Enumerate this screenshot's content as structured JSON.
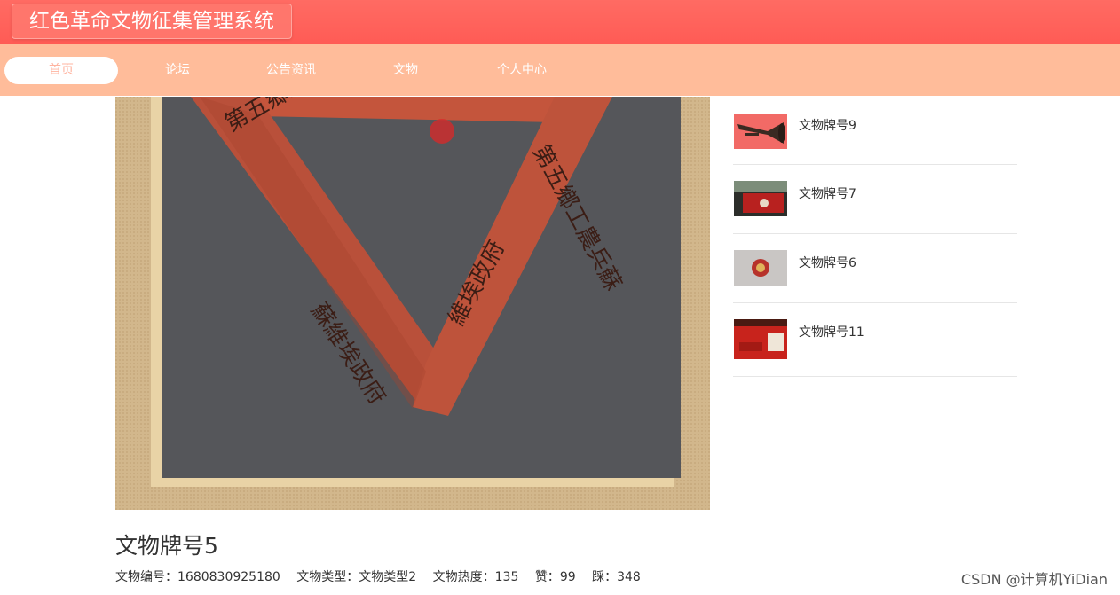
{
  "header": {
    "title": "红色革命文物征集管理系统"
  },
  "nav": {
    "items": [
      {
        "label": "首页",
        "active": true
      },
      {
        "label": "论坛"
      },
      {
        "label": "公告资讯"
      },
      {
        "label": "文物"
      },
      {
        "label": "个人中心"
      }
    ]
  },
  "detail": {
    "title": "文物牌号5",
    "meta": [
      {
        "label": "文物编号：",
        "value": "1680830925180"
      },
      {
        "label": "文物类型：",
        "value": "文物类型2"
      },
      {
        "label": "文物热度：",
        "value": "135"
      },
      {
        "label": "赞：",
        "value": "99"
      },
      {
        "label": "踩：",
        "value": "348"
      }
    ],
    "image_text": "第五鄉工農兵蘇維埃政府"
  },
  "sidebar": {
    "items": [
      {
        "label": "文物牌号9"
      },
      {
        "label": "文物牌号7"
      },
      {
        "label": "文物牌号6"
      },
      {
        "label": "文物牌号11"
      }
    ]
  },
  "watermark": "CSDN @计算机YiDian",
  "colors": {
    "header": "#ff5f58",
    "nav": "#ffbc9a",
    "nav_active_text": "#ffb4a0"
  }
}
